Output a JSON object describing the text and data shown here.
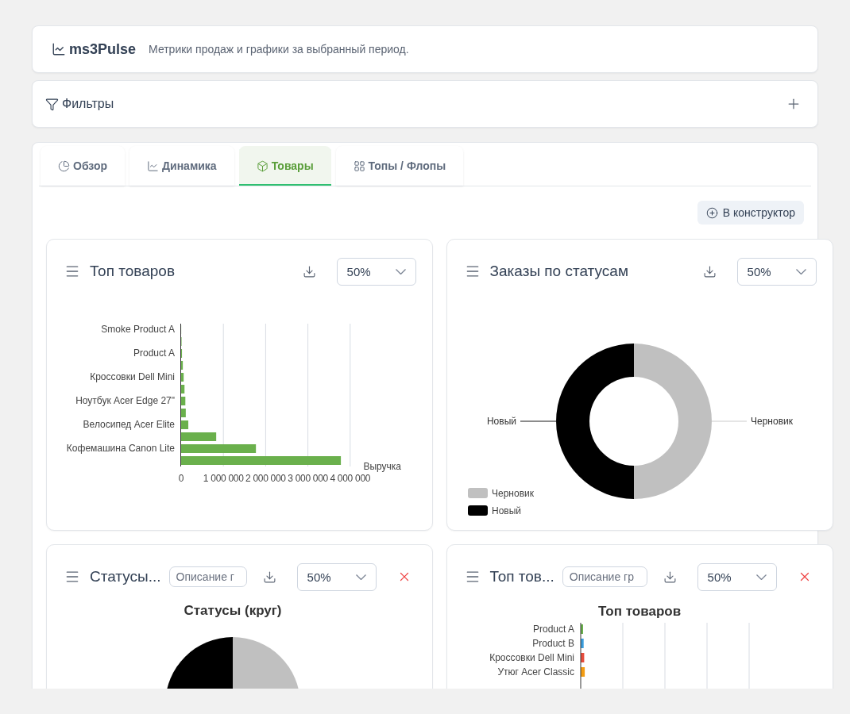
{
  "header": {
    "brand": "ms3Pulse",
    "subtitle": "Метрики продаж и графики за выбранный период."
  },
  "filters": {
    "title": "Фильтры",
    "expanded": false
  },
  "tabs": [
    {
      "label": "Обзор",
      "selected": false
    },
    {
      "label": "Динамика",
      "selected": false
    },
    {
      "label": "Товары",
      "selected": true
    },
    {
      "label": "Топы / Флопы",
      "selected": false
    }
  ],
  "add_button": "В конструктор",
  "widgets": [
    {
      "title": "Топ товаров",
      "size": "50%",
      "removable": false,
      "chart_data": {
        "type": "bar",
        "orientation": "horizontal",
        "categories": [
          "Smoke Product A",
          null,
          "Product A",
          null,
          "Кроссовки Dell Mini",
          null,
          "Ноутбук Acer Edge 27\"",
          null,
          "Велосипед Acer Elite",
          null,
          "Кофемашина Canon Lite",
          null
        ],
        "series": [
          {
            "name": "Выручка",
            "color": "#6ab04c",
            "values": [
              0,
              10000,
              20000,
              40000,
              60000,
              80000,
              100000,
              110000,
              170000,
              830000,
              1770000,
              3780000
            ]
          }
        ],
        "grid": true,
        "xlim": [
          0,
          4000000
        ],
        "xticks": [
          {
            "value": 0,
            "label": "0"
          },
          {
            "value": 1000000,
            "label": "1 000 000"
          },
          {
            "value": 2000000,
            "label": "2 000 000"
          },
          {
            "value": 3000000,
            "label": "3 000 000"
          },
          {
            "value": 4000000,
            "label": "4 000 000"
          }
        ]
      }
    },
    {
      "title": "Заказы по статусам",
      "size": "50%",
      "removable": false,
      "chart_data": {
        "type": "donut",
        "categories": [
          "Черновик",
          "Новый"
        ],
        "values": [
          50,
          50
        ],
        "colors": [
          "#c0c0c0",
          "#000000"
        ],
        "legend": "bottom-left"
      }
    },
    {
      "title": "Статусы...",
      "description_placeholder": "Описание г",
      "size": "50%",
      "removable": true,
      "chart_data": {
        "type": "pie",
        "title": "Статусы (круг)",
        "values": [
          50,
          50
        ],
        "colors": [
          "#c0c0c0",
          "#000000"
        ]
      }
    },
    {
      "title": "Топ тов...",
      "description_placeholder": "Описание гр",
      "size": "50%",
      "removable": true,
      "chart_heading": "Топ товаров",
      "chart_picture": {
        "kind": "bar",
        "items": [
          {
            "label": "Product A",
            "color": "#6ab04c"
          },
          {
            "label": "Product B",
            "color": "#3b9ddd"
          },
          {
            "label": "Кроссовки Dell Mini",
            "color": "#e74c3c"
          },
          {
            "label": "Утюг Acer Classic",
            "color": "#f39c12"
          }
        ]
      }
    }
  ]
}
